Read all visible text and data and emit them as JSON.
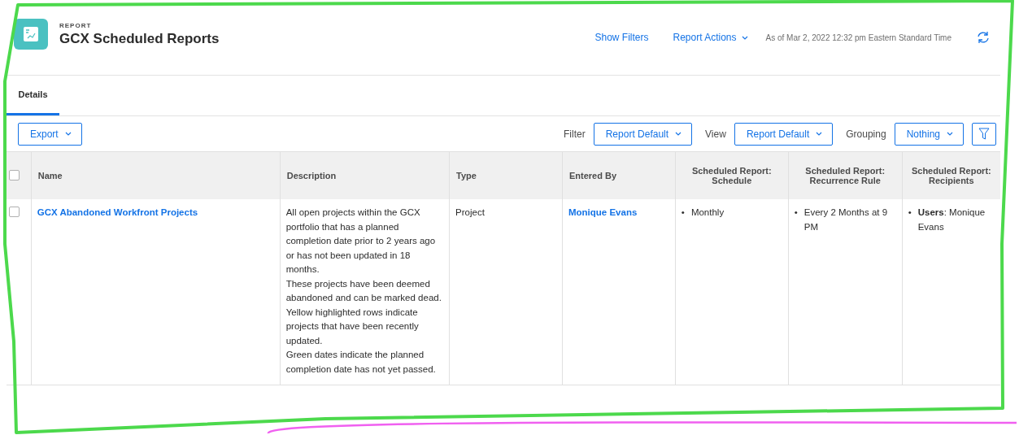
{
  "header": {
    "eyebrow": "REPORT",
    "title": "GCX Scheduled Reports",
    "links": [
      {
        "label": "Show Filters",
        "kind": "link"
      },
      {
        "label": "Report Actions",
        "kind": "menu"
      }
    ],
    "timestamp": "As of Mar 2, 2022 12:32 pm Eastern Standard Time"
  },
  "tabs": [
    {
      "label": "Details",
      "selected": true
    }
  ],
  "toolbar": {
    "export": "Export",
    "selects": [
      {
        "label": "Filter",
        "value": "Report Default"
      },
      {
        "label": "View",
        "value": "Report Default"
      },
      {
        "label": "Grouping",
        "value": "Nothing"
      }
    ]
  },
  "table": {
    "select_all_checked": false,
    "columns": [
      "Name",
      "Description",
      "Type",
      "Entered By",
      "Scheduled Report: Schedule",
      "Scheduled Report: Recurrence Rule",
      "Scheduled Report: Recipients"
    ],
    "rows": [
      {
        "checked": false,
        "name": "GCX Abandoned Workfront Projects",
        "description": [
          "All open projects within the GCX portfolio that has a planned completion date prior to 2 years ago or has not been updated in 18 months.",
          "These projects have been deemed abandoned and can be marked dead.",
          "Yellow highlighted rows indicate projects that have been recently updated.",
          "Green dates indicate the planned completion date has not yet passed."
        ],
        "type": "Project",
        "entered_by": "Monique Evans",
        "schedule": {
          "bullet": "•",
          "text": "Monthly"
        },
        "recurrence": {
          "bullet": "•",
          "text": "Every 2 Months at 9 PM"
        },
        "recipients": {
          "bullet": "•",
          "text": "**Users**: Monique Evans"
        }
      }
    ]
  }
}
